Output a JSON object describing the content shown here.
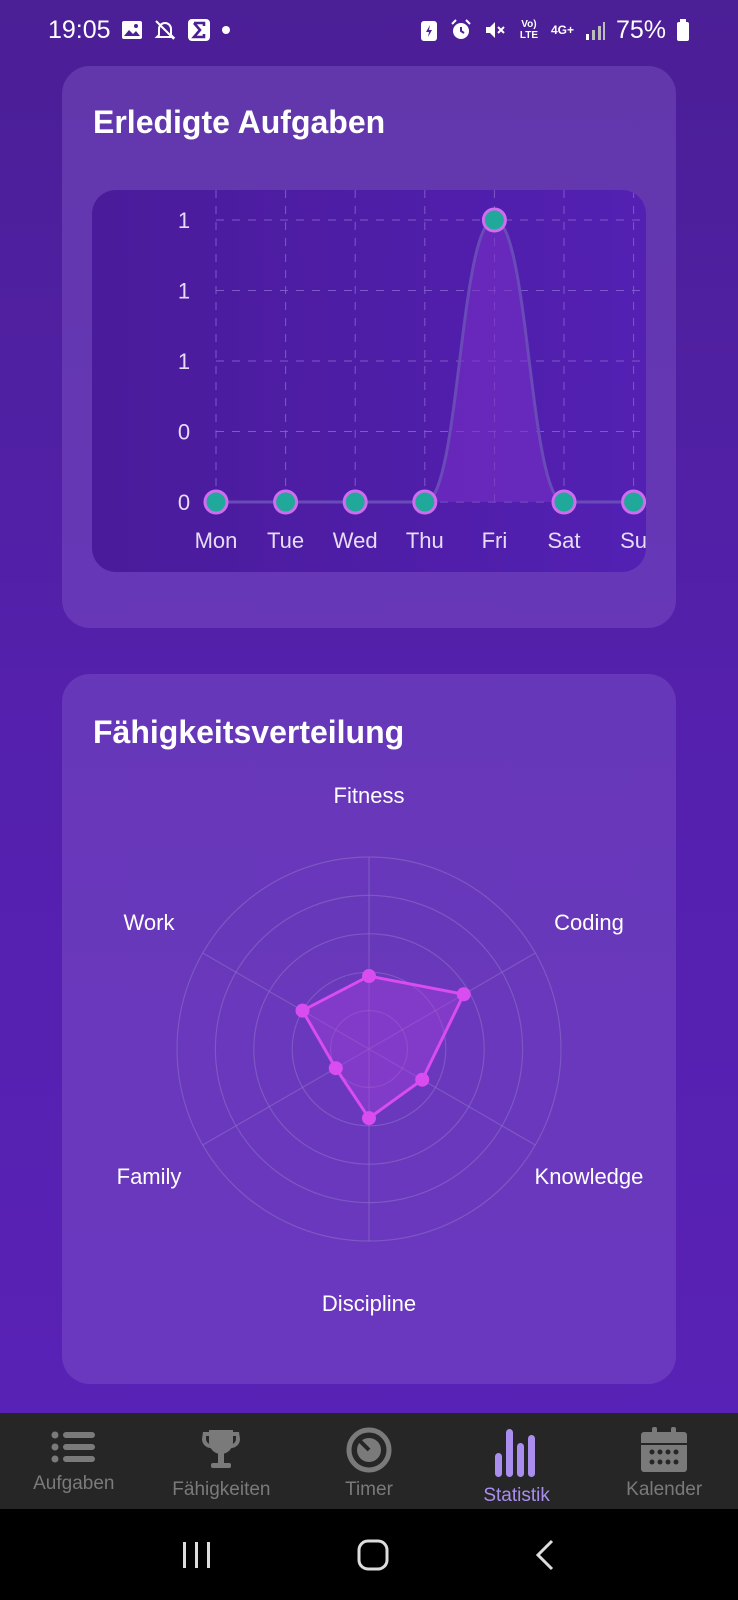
{
  "status_bar": {
    "time": "19:05",
    "battery": "75%",
    "network_volte": "Vo) LTE",
    "network_4g": "4G+"
  },
  "tasks_card": {
    "title": "Erledigte Aufgaben"
  },
  "skills_card": {
    "title": "Fähigkeitsverteilung"
  },
  "chart_data": [
    {
      "type": "line",
      "title": "Erledigte Aufgaben",
      "categories": [
        "Mon",
        "Tue",
        "Wed",
        "Thu",
        "Fri",
        "Sat",
        "Sun"
      ],
      "visible_tick_labels_x": [
        "Mon",
        "Tue",
        "Wed",
        "Thu",
        "Fri",
        "Sat",
        "Su"
      ],
      "series": [
        {
          "values": [
            0,
            0,
            0,
            0,
            1,
            0,
            0
          ]
        }
      ],
      "y_tick_labels": [
        "1",
        "1",
        "1",
        "0",
        "0"
      ],
      "ylim": [
        0,
        1
      ],
      "grid": true,
      "area_fill": true,
      "colors": {
        "line": "#6a4ab8",
        "point_fill": "#20a99a",
        "point_stroke": "#d06cf0",
        "area": "#7a30c8"
      }
    },
    {
      "type": "radar",
      "title": "Fähigkeitsverteilung",
      "categories": [
        "Fitness",
        "Coding",
        "Knowledge",
        "Discipline",
        "Family",
        "Work"
      ],
      "series": [
        {
          "values": [
            0.38,
            0.57,
            0.32,
            0.36,
            0.2,
            0.4
          ]
        }
      ],
      "rings": 5,
      "colors": {
        "line": "#d84cf0",
        "area": "#a040d8",
        "grid": "#8a6cc8"
      }
    }
  ],
  "bottom_nav": {
    "items": [
      {
        "label": "Aufgaben",
        "icon": "list-icon",
        "active": false
      },
      {
        "label": "Fähigkeiten",
        "icon": "trophy-icon",
        "active": false
      },
      {
        "label": "Timer",
        "icon": "timer-icon",
        "active": false
      },
      {
        "label": "Statistik",
        "icon": "bar-chart-icon",
        "active": true
      },
      {
        "label": "Kalender",
        "icon": "calendar-icon",
        "active": false
      }
    ]
  }
}
